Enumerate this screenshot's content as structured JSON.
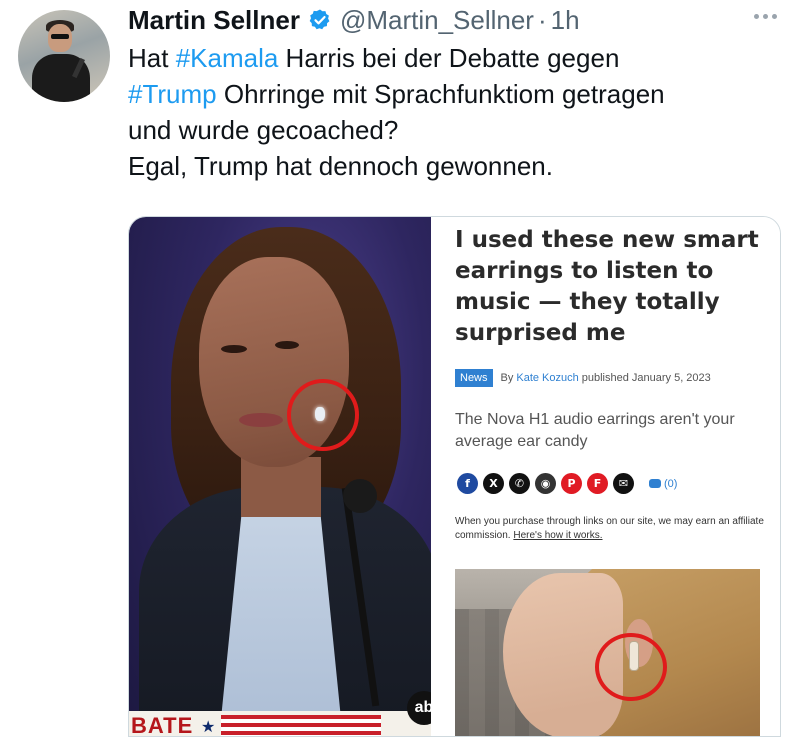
{
  "tweet": {
    "author_name": "Martin Sellner",
    "handle": "@Martin_Sellner",
    "separator": "·",
    "time": "1h",
    "lines": [
      [
        {
          "t": "Hat ",
          "h": false
        },
        {
          "t": "#Kamala",
          "h": true
        },
        {
          "t": " Harris bei der Debatte gegen",
          "h": false
        }
      ],
      [
        {
          "t": "#Trump",
          "h": true
        },
        {
          "t": " Ohrringe mit Sprachfunktiom getragen",
          "h": false
        }
      ],
      [
        {
          "t": "und wurde gecoached?",
          "h": false
        }
      ],
      [
        {
          "t": "Egal, Trump hat dennoch gewonnen.",
          "h": false
        }
      ]
    ]
  },
  "colors": {
    "hashtag": "#1d9bf0",
    "verified": "#1d9bf0",
    "annotation_circle": "#e01b1b"
  },
  "left_image": {
    "banner_text": "BATE",
    "banner_star": "★",
    "logo_text": "ab"
  },
  "article": {
    "title": "I used these new smart earrings to listen to music — they totally surprised me",
    "tag": "News",
    "by": "By",
    "author": "Kate Kozuch",
    "published": "published January 5, 2023",
    "subtitle": "The Nova H1 audio earrings aren't your average ear candy",
    "share_icons": [
      {
        "icon": "facebook-icon",
        "glyph": "f",
        "color": "#1f4aa0"
      },
      {
        "icon": "x-icon",
        "glyph": "X",
        "color": "#111111"
      },
      {
        "icon": "whatsapp-icon",
        "glyph": "✆",
        "color": "#111111"
      },
      {
        "icon": "reddit-icon",
        "glyph": "◉",
        "color": "#333333"
      },
      {
        "icon": "pinterest-icon",
        "glyph": "P",
        "color": "#e01b24"
      },
      {
        "icon": "flipboard-icon",
        "glyph": "F",
        "color": "#e01b24"
      },
      {
        "icon": "email-icon",
        "glyph": "✉",
        "color": "#111111"
      }
    ],
    "comments_count": "(0)",
    "disclaimer_text": "When you purchase through links on our site, we may earn an affiliate commission. ",
    "disclaimer_link": "Here's how it works."
  }
}
